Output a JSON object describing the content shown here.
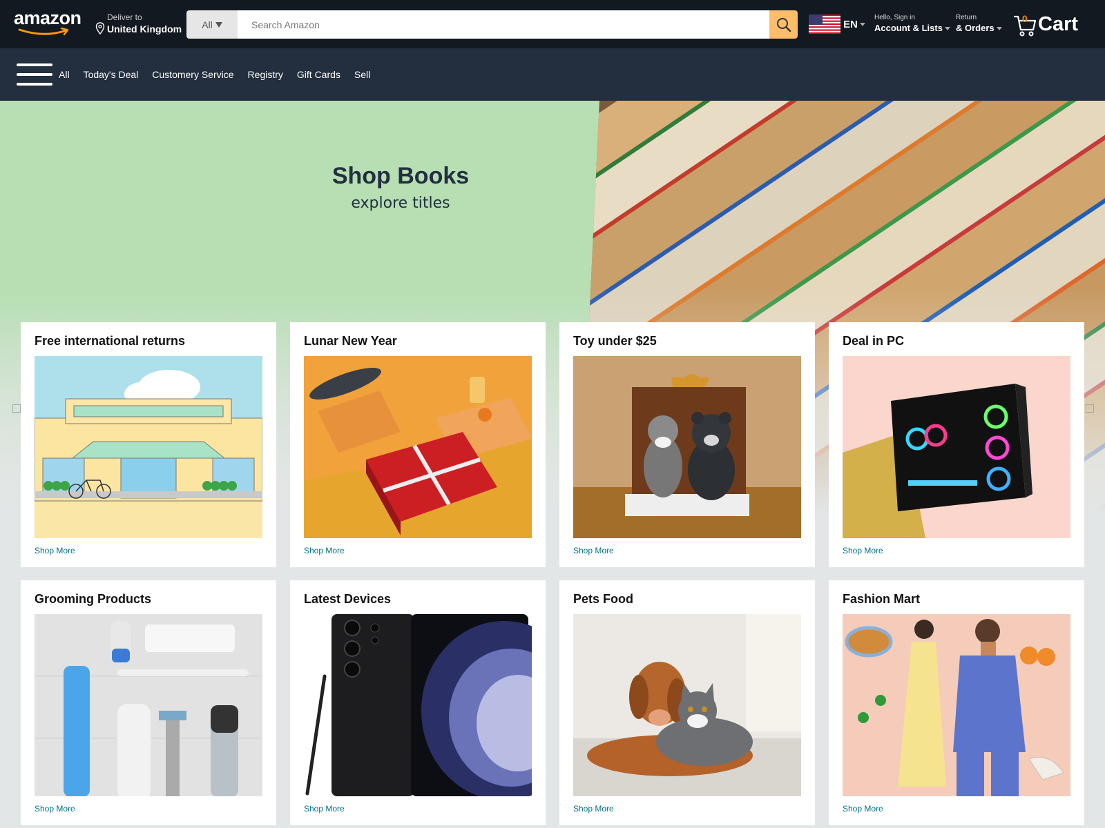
{
  "header": {
    "logo_text": "amazon",
    "deliver_line1": "Deliver to",
    "deliver_line2": "United Kingdom",
    "search_category": "All",
    "search_placeholder": "Search Amazon",
    "language": "EN",
    "account_line1": "Hello, Sign in",
    "account_line2": "Account & Lists",
    "orders_line1": "Return",
    "orders_line2": "& Orders",
    "cart_count": "0",
    "cart_label": "Cart"
  },
  "nav": {
    "items": [
      "All",
      "Today's Deal",
      "Customery Service",
      "Registry",
      "Gift Cards",
      "Sell"
    ]
  },
  "hero": {
    "title": "Shop Books",
    "subtitle": "explore titles"
  },
  "cards": [
    {
      "title": "Free international returns",
      "link": "Shop More"
    },
    {
      "title": "Lunar New Year",
      "link": "Shop More"
    },
    {
      "title": "Toy under $25",
      "link": "Shop More"
    },
    {
      "title": "Deal in PC",
      "link": "Shop More"
    },
    {
      "title": "Grooming Products",
      "link": "Shop More"
    },
    {
      "title": "Latest Devices",
      "link": "Shop More"
    },
    {
      "title": "Pets Food",
      "link": "Shop More"
    },
    {
      "title": "Fashion Mart",
      "link": "Shop More"
    }
  ],
  "colors": {
    "header_bg": "#131921",
    "subnav_bg": "#232f3e",
    "search_button": "#febd69",
    "link": "#007185",
    "hero_bg": "#b7dfb3"
  },
  "icons": [
    "location-pin-icon",
    "search-icon",
    "us-flag-icon",
    "cart-icon",
    "hamburger-icon"
  ]
}
